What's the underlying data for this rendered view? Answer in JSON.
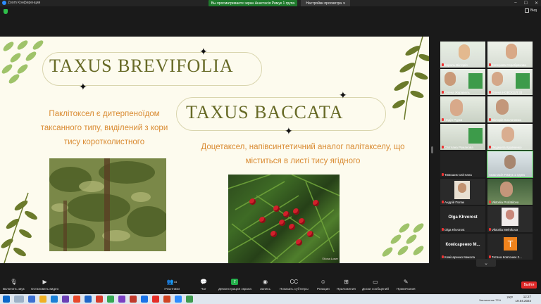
{
  "window": {
    "app_title": "Zoom Конференции",
    "viewing_banner": "Вы просматриваете экран Анастасія Римук 1 група",
    "view_options": "Настройки просмотра",
    "view_button": "Вид"
  },
  "slide": {
    "title1": "TAXUS BREVIFOLIA",
    "title2": "TAXUS BACCATA",
    "text1": "Паклітоксел є дитерпеноїдом таксанного типу, виділений з кори тису коротколистного",
    "text2": "Доцетаксел, напівсинтетичний аналог палітакселу, що міститься в листі тису ягідного",
    "photo2_caption": "©Ilona Loser"
  },
  "gallery": [
    {
      "name": "Король Вікторія"
    },
    {
      "name": "Коперова Серебрякова"
    },
    {
      "name": "Олена Журавель"
    },
    {
      "name": "Олена НОВОСЕЛ 33"
    },
    {
      "name": "Надія Рудка"
    },
    {
      "name": "Вікторія Кислоченко"
    },
    {
      "name": "Світлана Романова"
    },
    {
      "name": "Людмила Кравченко"
    },
    {
      "name": "Тимошик Світлана"
    },
    {
      "name": "Анастасія Римук 1 група"
    },
    {
      "name": "Андрій Попак"
    },
    {
      "name": "Viktoriia Profatilova"
    },
    {
      "name": "Olga Khvorost",
      "big": "Olga Khvorost"
    },
    {
      "name": "Viktoriia Melnikova"
    },
    {
      "name": "Комісаренко Микола",
      "big": "Комісаренко М..."
    },
    {
      "name": "Тетяна Ковтонюк 2...",
      "avatar": "T"
    }
  ],
  "toolbar": {
    "audio": "Включить звук",
    "video": "Остановить видео",
    "participants": "Участники",
    "participants_count": "34",
    "chat": "Чат",
    "share": "Демонстрация экрана",
    "record": "Запись",
    "captions": "Показать субтитры",
    "reactions": "Реакции",
    "apps": "Приложения",
    "board": "Доски сообщений",
    "notes": "Примечания",
    "leave": "Выйти"
  },
  "taskbar": {
    "lang": "УКР",
    "time": "12:27",
    "date": "19.04.2024",
    "zoom_level": "Увеличение 72%"
  },
  "colors": {
    "slide_bg": "#fdfbee",
    "title_olive": "#676a26",
    "text_orange": "#d98b32",
    "leaf_green": "#9fc36a",
    "zoom_green": "#1f7a2c",
    "leave_red": "#e02828"
  }
}
